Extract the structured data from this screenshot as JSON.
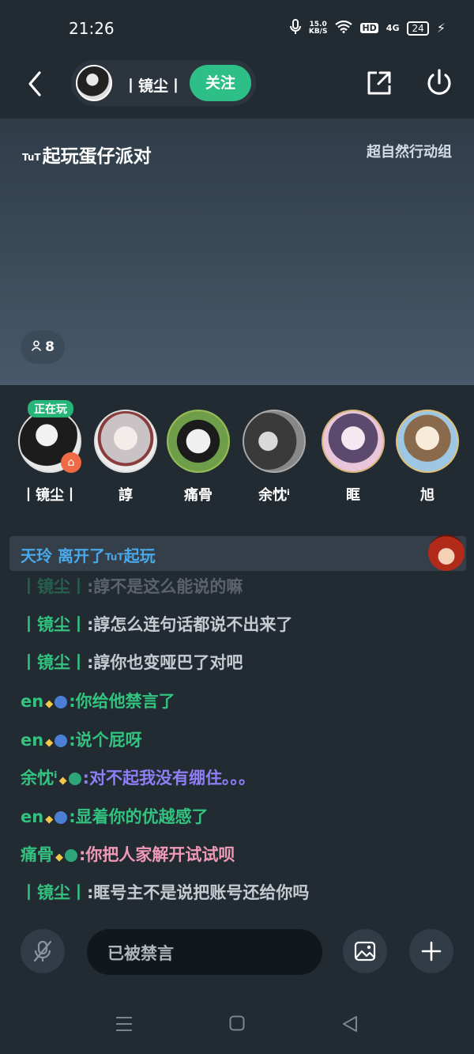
{
  "status": {
    "time": "21:26",
    "speed_value": "15.0",
    "speed_unit": "KB/S",
    "hd": "HD",
    "network": "4G",
    "battery": "24"
  },
  "header": {
    "host_name": "丨镜尘丨",
    "follow_label": "关注"
  },
  "room": {
    "tag": "TuT",
    "title": "起玩蛋仔派对",
    "category": "超自然行动组",
    "member_count": "8"
  },
  "seats": [
    {
      "name": "丨镜尘丨",
      "badge": "正在玩"
    },
    {
      "name": "諄"
    },
    {
      "name": "痛骨"
    },
    {
      "name": "余忱ⁱ"
    },
    {
      "name": "眶"
    },
    {
      "name": "旭"
    }
  ],
  "notice": {
    "user": "天玲",
    "action": "离开了",
    "tag": "TuT",
    "target": "起玩"
  },
  "messages": [
    {
      "sender": "丨镜尘丨",
      "sep": ":",
      "text": "諄不是这么能说的嘛"
    },
    {
      "sender": "丨镜尘丨",
      "sep": ":",
      "text": "諄怎么连句话都说不出来了"
    },
    {
      "sender": "丨镜尘丨",
      "sep": ":",
      "text": "諄你也变哑巴了对吧"
    },
    {
      "sender": "en",
      "sep": ":",
      "text": "你给他禁言了"
    },
    {
      "sender": "en",
      "sep": ":",
      "text": "说个屁呀"
    },
    {
      "sender": "余忱ⁱ",
      "sep": ":",
      "text": "对不起我没有绷住。。。"
    },
    {
      "sender": "en",
      "sep": ":",
      "text": "显着你的优越感了"
    },
    {
      "sender": "痛骨",
      "sep": ":",
      "text": "你把人家解开试试呗"
    },
    {
      "sender": "丨镜尘丨",
      "sep": ":",
      "text": "眶号主不是说把账号还给你吗"
    }
  ],
  "input": {
    "placeholder": "已被禁言"
  }
}
